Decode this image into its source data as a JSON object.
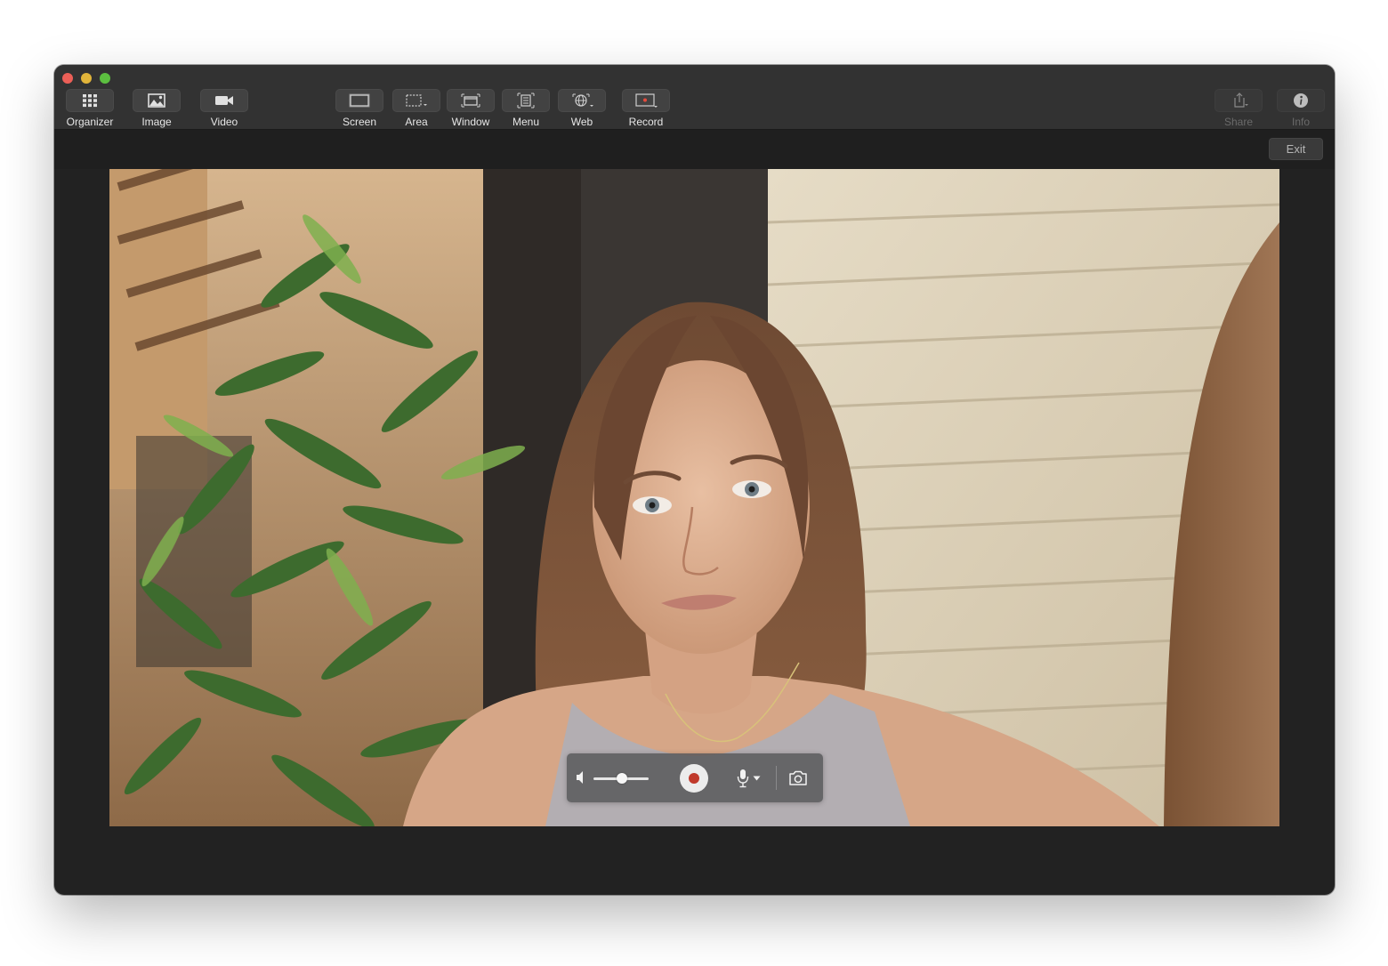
{
  "toolbar": {
    "items": [
      {
        "label": "Organizer",
        "icon": "grid-icon"
      },
      {
        "label": "Image",
        "icon": "image-icon"
      },
      {
        "label": "Video",
        "icon": "video-camera-icon"
      },
      {
        "label": "Screen",
        "icon": "screen-capture-icon"
      },
      {
        "label": "Area",
        "icon": "area-capture-icon"
      },
      {
        "label": "Window",
        "icon": "window-capture-icon"
      },
      {
        "label": "Menu",
        "icon": "menu-capture-icon"
      },
      {
        "label": "Web",
        "icon": "web-capture-icon"
      },
      {
        "label": "Record",
        "icon": "record-screen-icon"
      }
    ],
    "right_items": [
      {
        "label": "Share",
        "icon": "share-icon",
        "enabled": false
      },
      {
        "label": "Info",
        "icon": "info-icon",
        "enabled": false
      }
    ]
  },
  "subbar": {
    "exit_label": "Exit"
  },
  "recording_controls": {
    "volume_level": 0.52,
    "icons": [
      "speaker-icon",
      "record-button-icon",
      "microphone-icon",
      "chevron-down-icon",
      "camera-snapshot-icon"
    ],
    "record_color": "#c0392b"
  },
  "colors": {
    "window_bg": "#222222",
    "toolbar_bg": "#323232",
    "button_bg": "#424242",
    "label_text": "#e6e6e6",
    "disabled_text": "#6a6a6a"
  }
}
